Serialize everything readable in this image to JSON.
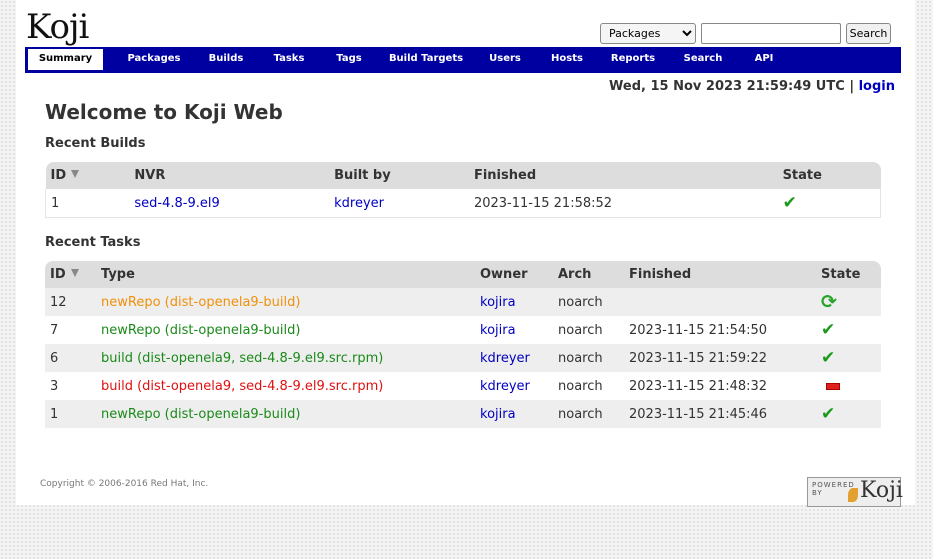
{
  "app": {
    "logo_text": "Koji"
  },
  "search": {
    "selected_option": "Packages",
    "input_value": "",
    "button_label": "Search"
  },
  "nav": {
    "tabs": [
      {
        "label": "Summary",
        "active": true
      },
      {
        "label": "Packages"
      },
      {
        "label": "Builds"
      },
      {
        "label": "Tasks"
      },
      {
        "label": "Tags"
      },
      {
        "label": "Build Targets"
      },
      {
        "label": "Users"
      },
      {
        "label": "Hosts"
      },
      {
        "label": "Reports"
      },
      {
        "label": "Search"
      },
      {
        "label": "API"
      }
    ]
  },
  "header": {
    "datetime": "Wed, 15 Nov 2023 21:59:49 UTC",
    "separator": "|",
    "login_label": "login"
  },
  "page": {
    "title": "Welcome to Koji Web"
  },
  "recent_builds": {
    "heading": "Recent Builds",
    "columns": [
      "ID",
      "NVR",
      "Built by",
      "Finished",
      "State"
    ],
    "rows": [
      {
        "id": "1",
        "nvr": "sed-4.8-9.el9",
        "built_by": "kdreyer",
        "finished": "2023-11-15 21:58:52",
        "state": "complete"
      }
    ]
  },
  "recent_tasks": {
    "heading": "Recent Tasks",
    "columns": [
      "ID",
      "Type",
      "Owner",
      "Arch",
      "Finished",
      "State"
    ],
    "rows": [
      {
        "id": "12",
        "type": "newRepo (dist-openela9-build)",
        "owner": "kojira",
        "arch": "noarch",
        "finished": "",
        "state": "open",
        "type_color": "#f0900a"
      },
      {
        "id": "7",
        "type": "newRepo (dist-openela9-build)",
        "owner": "kojira",
        "arch": "noarch",
        "finished": "2023-11-15 21:54:50",
        "state": "closed",
        "type_color": "#1a8a1a"
      },
      {
        "id": "6",
        "type": "build (dist-openela9, sed-4.8-9.el9.src.rpm)",
        "owner": "kdreyer",
        "arch": "noarch",
        "finished": "2023-11-15 21:59:22",
        "state": "closed",
        "type_color": "#1a8a1a"
      },
      {
        "id": "3",
        "type": "build (dist-openela9, sed-4.8-9.el9.src.rpm)",
        "owner": "kdreyer",
        "arch": "noarch",
        "finished": "2023-11-15 21:48:32",
        "state": "failed",
        "type_color": "#e01010"
      },
      {
        "id": "1",
        "type": "newRepo (dist-openela9-build)",
        "owner": "kojira",
        "arch": "noarch",
        "finished": "2023-11-15 21:45:46",
        "state": "closed",
        "type_color": "#1a8a1a"
      }
    ]
  },
  "footer": {
    "copyright": "Copyright © 2006-2016 Red Hat, Inc.",
    "powered_by": "POWERED BY",
    "powered_logo": "Koji"
  }
}
